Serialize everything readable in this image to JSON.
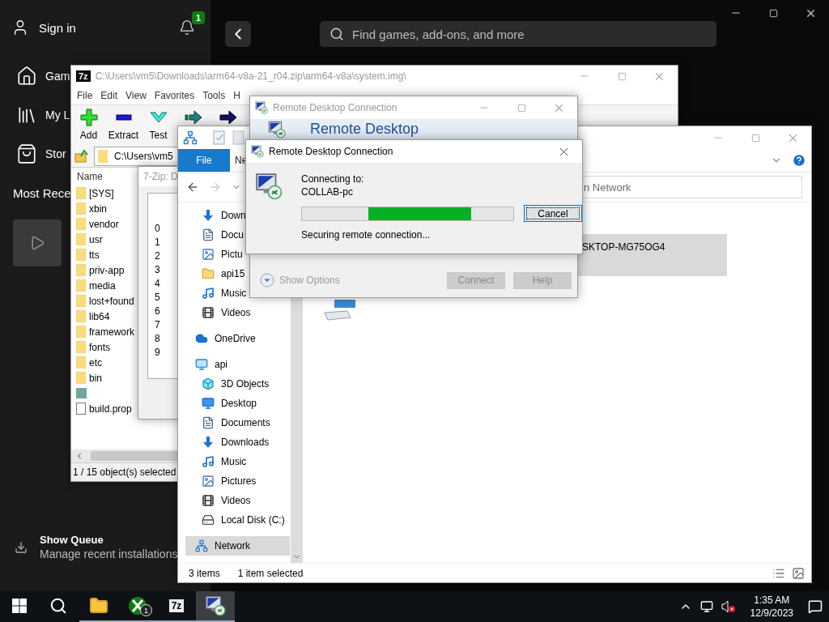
{
  "xbox": {
    "account": "Sign in",
    "notification_count": "1",
    "search": {
      "placeholder": "Find games, add-ons, and more"
    },
    "nav": [
      {
        "label": "Gam",
        "kind": "home"
      },
      {
        "label": "My L",
        "kind": "library"
      },
      {
        "label": "Stor",
        "kind": "store"
      }
    ],
    "section_title": "Most Rece",
    "queue": {
      "title": "Show Queue",
      "subtitle": "Manage recent installations"
    }
  },
  "sevenzip": {
    "logo": "7z",
    "title": "C:\\Users\\vm5\\Downloads\\arm64-v8a-21_r04.zip\\arm64-v8a\\system.img\\",
    "menu": [
      "File",
      "Edit",
      "View",
      "Favorites",
      "Tools",
      "H"
    ],
    "toolbar": [
      {
        "label": "Add",
        "kind": "add"
      },
      {
        "label": "Extract",
        "kind": "extract"
      },
      {
        "label": "Test",
        "kind": "test"
      },
      {
        "kind": "copy"
      },
      {
        "kind": "move"
      }
    ],
    "address": "C:\\Users\\vm5",
    "column": "Name",
    "files": [
      {
        "name": "[SYS]",
        "kind": "folder"
      },
      {
        "name": "xbin",
        "kind": "folder"
      },
      {
        "name": "vendor",
        "kind": "folder"
      },
      {
        "name": "usr",
        "kind": "folder"
      },
      {
        "name": "tts",
        "kind": "folder"
      },
      {
        "name": "priv-app",
        "kind": "folder"
      },
      {
        "name": "media",
        "kind": "folder"
      },
      {
        "name": "lost+found",
        "kind": "folder"
      },
      {
        "name": "lib64",
        "kind": "folder"
      },
      {
        "name": "framework",
        "kind": "folder"
      },
      {
        "name": "fonts",
        "kind": "folder"
      },
      {
        "name": "etc",
        "kind": "folder"
      },
      {
        "name": "bin",
        "kind": "folder"
      },
      {
        "kind": "image"
      },
      {
        "name": "build.prop",
        "kind": "file"
      }
    ],
    "status": "1 / 15 object(s) selected"
  },
  "sevenzip_dialog": {
    "title": "7-Zip: D",
    "rows": [
      "0",
      "1",
      "2",
      "3",
      "4",
      "5",
      "6",
      "7",
      "8",
      "9"
    ]
  },
  "explorer": {
    "ribbon_tabs": [
      {
        "label": "File",
        "selected": true
      },
      {
        "label": "Ne",
        "selected": false
      }
    ],
    "search": {
      "placeholder": "n Network"
    },
    "quick_access": [
      {
        "label": "Down",
        "kind": "download",
        "selected": false
      },
      {
        "label": "Docu",
        "kind": "document",
        "selected": false
      },
      {
        "label": "Pictu",
        "kind": "picture",
        "selected": false
      },
      {
        "label": "api15",
        "kind": "folder",
        "selected": false
      },
      {
        "label": "Music",
        "kind": "music",
        "selected": false
      },
      {
        "label": "Videos",
        "kind": "video",
        "selected": false
      }
    ],
    "tree": [
      {
        "label": "OneDrive",
        "kind": "cloud",
        "selected": false
      },
      {
        "label": "api",
        "kind": "computer",
        "selected": false,
        "children": [
          {
            "label": "3D Objects",
            "kind": "cube",
            "selected": false
          },
          {
            "label": "Desktop",
            "kind": "desktop",
            "selected": false
          },
          {
            "label": "Documents",
            "kind": "document",
            "selected": false
          },
          {
            "label": "Downloads",
            "kind": "download",
            "selected": false
          },
          {
            "label": "Music",
            "kind": "music",
            "selected": false
          },
          {
            "label": "Pictures",
            "kind": "picture",
            "selected": false
          },
          {
            "label": "Videos",
            "kind": "video",
            "selected": false
          },
          {
            "label": "Local Disk (C:)",
            "kind": "disk",
            "selected": false
          }
        ]
      },
      {
        "label": "Network",
        "kind": "network",
        "selected": true
      }
    ],
    "content": {
      "computer_name": "SKTOP-MG75OG4",
      "selected": true
    },
    "status": [
      "3 items",
      "1 item selected"
    ]
  },
  "rdc_window": {
    "title": "Remote Desktop Connection",
    "banner": "Remote Desktop",
    "show_options": "Show Options",
    "buttons": [
      {
        "label": "Connect",
        "disabled": true
      },
      {
        "label": "Help",
        "disabled": true
      }
    ]
  },
  "rdc_dialog": {
    "title": "Remote Desktop Connection",
    "connecting_label": "Connecting to:",
    "host": "COLLAB-pc",
    "status": "Securing remote connection...",
    "cancel": "Cancel"
  },
  "taskbar": {
    "apps": [
      {
        "kind": "explorer",
        "active": false
      },
      {
        "kind": "xbox",
        "badge": "1",
        "active": false
      },
      {
        "kind": "sevenzip",
        "label": "7z",
        "active": false
      },
      {
        "kind": "rdc",
        "active": true
      }
    ],
    "time": "1:35 AM",
    "date": "12/9/2023"
  }
}
